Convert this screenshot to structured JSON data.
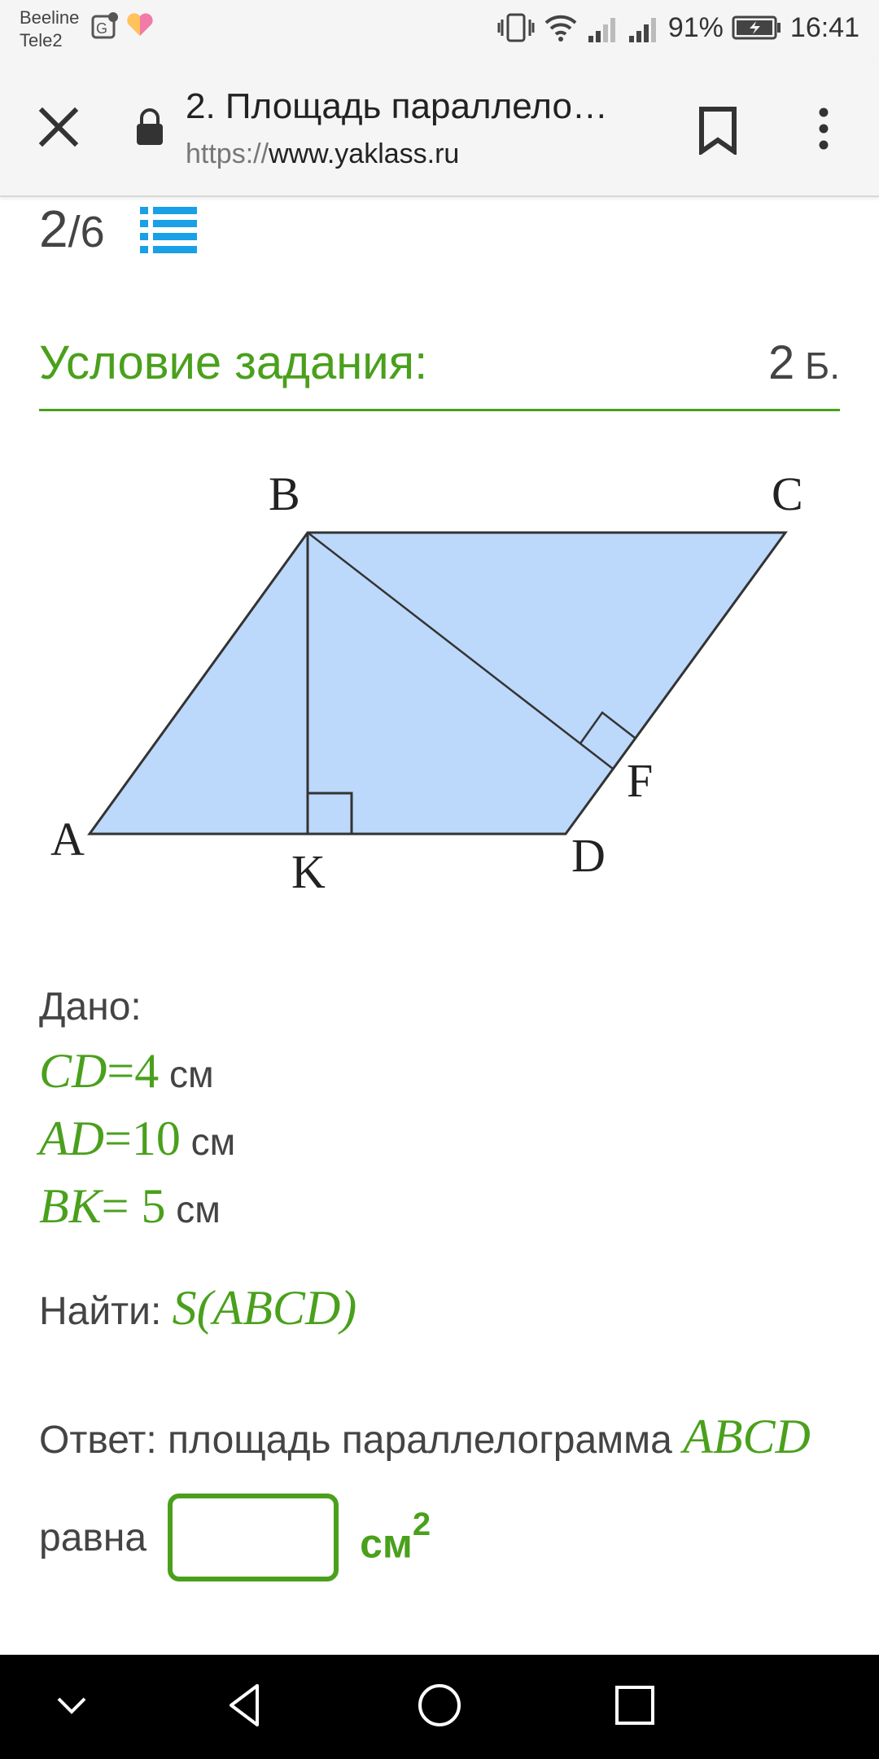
{
  "status_bar": {
    "carrier1": "Beeline",
    "carrier2": "Tele2",
    "battery": "91%",
    "time": "16:41"
  },
  "browser": {
    "title": "2. Площадь параллело…",
    "url_protocol": "https://",
    "url_host": "www.yaklass.ru"
  },
  "task": {
    "counter_current": "2",
    "counter_total": "/6",
    "section_title": "Условие задания:",
    "points_value": "2",
    "points_unit": " Б."
  },
  "figure": {
    "fill_color": "#bcd8fb",
    "labels": {
      "A": "A",
      "B": "B",
      "C": "C",
      "D": "D",
      "K": "K",
      "F": "F"
    }
  },
  "given": {
    "label": "Дано:",
    "cd_var": "CD",
    "cd_val": "=4",
    "cd_unit": " см",
    "ad_var": "AD",
    "ad_val": "=10",
    "ad_unit": " см",
    "bk_var": "BK",
    "bk_val": "= 5",
    "bk_unit": " см"
  },
  "find": {
    "label": "Найти: ",
    "expr": "S(ABCD)"
  },
  "answer": {
    "prefix": "Ответ: площадь параллелограмма ",
    "expr": "ABCD",
    "line2": "равна",
    "input_value": "",
    "unit": "см",
    "unit_sup": "2"
  },
  "colors": {
    "accent": "#4aa01c",
    "icon_blue": "#1aa0e6"
  },
  "icons": [
    "close-icon",
    "lock-icon",
    "bookmark-icon",
    "more-vert-icon",
    "list-icon",
    "back-icon",
    "home-icon",
    "recents-icon",
    "chevron-down-icon"
  ]
}
